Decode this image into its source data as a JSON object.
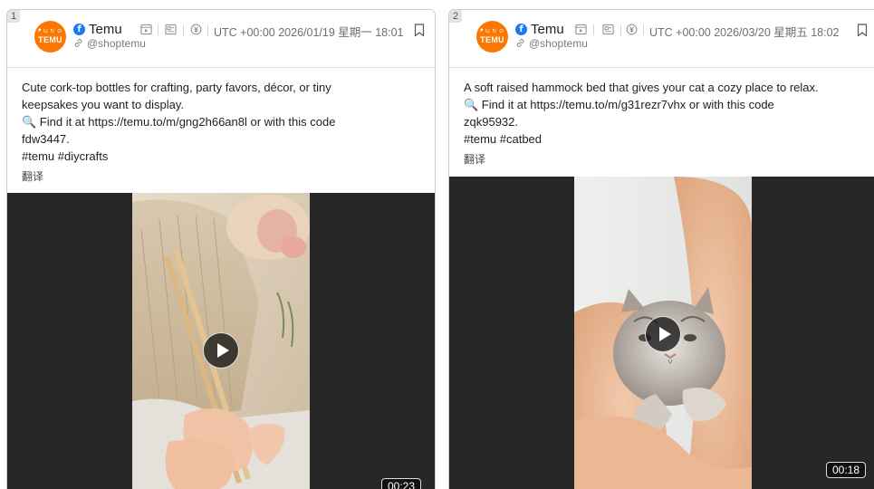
{
  "cards": [
    {
      "index": "1",
      "avatar": {
        "line1": "ᖰ ⊔ ↻ ⊙",
        "line2": "TEMU"
      },
      "page_name": "Temu",
      "handle": "@shoptemu",
      "timestamp": "UTC +00:00 2026/01/19 星期一 18:01",
      "text_lines": [
        "Cute cork-top bottles for crafting, party favors, décor, or tiny",
        "keepsakes you want to display.",
        "🔍 Find it at https://temu.to/m/gng2h66an8l or with this code",
        "fdw3447.",
        "#temu #diycrafts"
      ],
      "translate_label": "翻译",
      "video_duration": "00:23"
    },
    {
      "index": "2",
      "avatar": {
        "line1": "ᖰ ⊔ ↻ ⊙",
        "line2": "TEMU"
      },
      "page_name": "Temu",
      "handle": "@shoptemu",
      "timestamp": "UTC +00:00 2026/03/20 星期五 18:02",
      "text_lines": [
        "A soft raised hammock bed that gives your cat a cozy place to relax.",
        "🔍 Find it at https://temu.to/m/g31rezr7vhx or with this code",
        "zqk95932.",
        "#temu #catbed"
      ],
      "translate_label": "翻译",
      "video_duration": "00:18"
    }
  ],
  "icons": {
    "platform": "facebook-icon",
    "link": "link-icon",
    "video_type": "video-icon",
    "post_type": "post-icon",
    "currency": "yuan-icon",
    "save": "bookmark-icon",
    "play": "play-icon"
  },
  "colors": {
    "brand_orange": "#fb7701",
    "facebook_blue": "#1877f2",
    "video_bg": "#272727"
  }
}
